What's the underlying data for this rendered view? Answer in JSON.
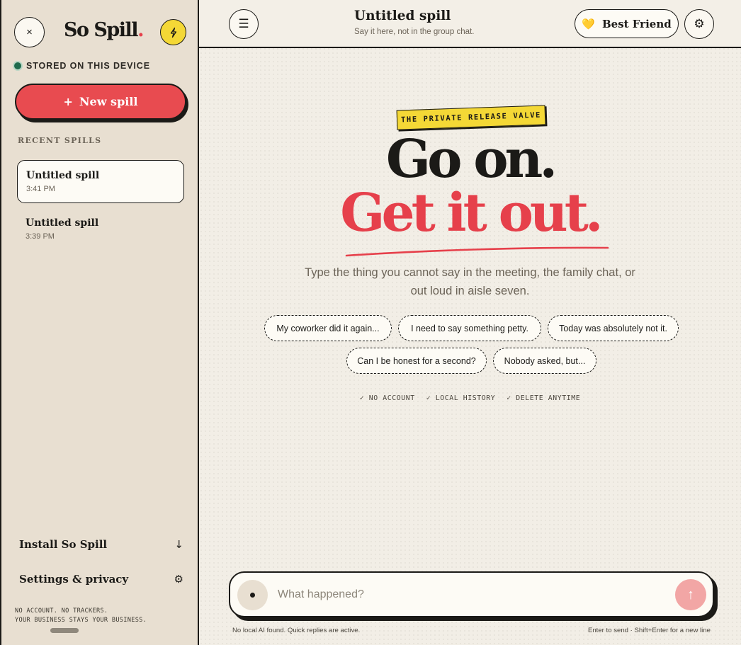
{
  "sidebar": {
    "close_icon": "×",
    "logo_text": "So Spill",
    "logo_dot": ".",
    "storage_status": "STORED ON THIS DEVICE",
    "new_spill_plus": "+",
    "new_spill_label": "New spill",
    "recent_label": "RECENT SPILLS",
    "recent": [
      {
        "title": "Untitled spill",
        "time": "3:41 PM"
      },
      {
        "title": "Untitled spill",
        "time": "3:39 PM"
      }
    ],
    "install_label": "Install So Spill",
    "install_icon": "↓",
    "settings_label": "Settings & privacy",
    "settings_icon": "⚙",
    "footnote_line1": "NO ACCOUNT. NO TRACKERS.",
    "footnote_line2": "YOUR BUSINESS STAYS YOUR BUSINESS."
  },
  "header": {
    "menu_icon": "☰",
    "title": "Untitled spill",
    "subtitle": "Say it here, not in the group chat.",
    "persona_icon": "💛",
    "persona_label": "Best Friend",
    "settings_icon": "⚙"
  },
  "hero": {
    "badge": "THE PRIVATE RELEASE VALVE",
    "line1": "Go on.",
    "line2": "Get it out.",
    "lead": "Type the thing you cannot say in the meeting, the family chat, or out loud in aisle seven."
  },
  "prompts": [
    "My coworker did it again...",
    "I need to say something petty.",
    "Today was absolutely not it.",
    "Can I be honest for a second?",
    "Nobody asked, but..."
  ],
  "features": [
    "✓ NO ACCOUNT",
    "✓ LOCAL HISTORY",
    "✓ DELETE ANYTIME"
  ],
  "composer": {
    "placeholder": "What happened?",
    "value": "",
    "send_icon": "↑",
    "note_left": "No local AI found. Quick replies are active.",
    "note_right": "Enter to send · Shift+Enter for a new line"
  },
  "colors": {
    "accent_red": "#e6404b",
    "accent_yellow": "#f4d836",
    "ink": "#1b1a17",
    "sidebar_bg": "#e8dfd1",
    "status_green": "#1f6b4d"
  }
}
